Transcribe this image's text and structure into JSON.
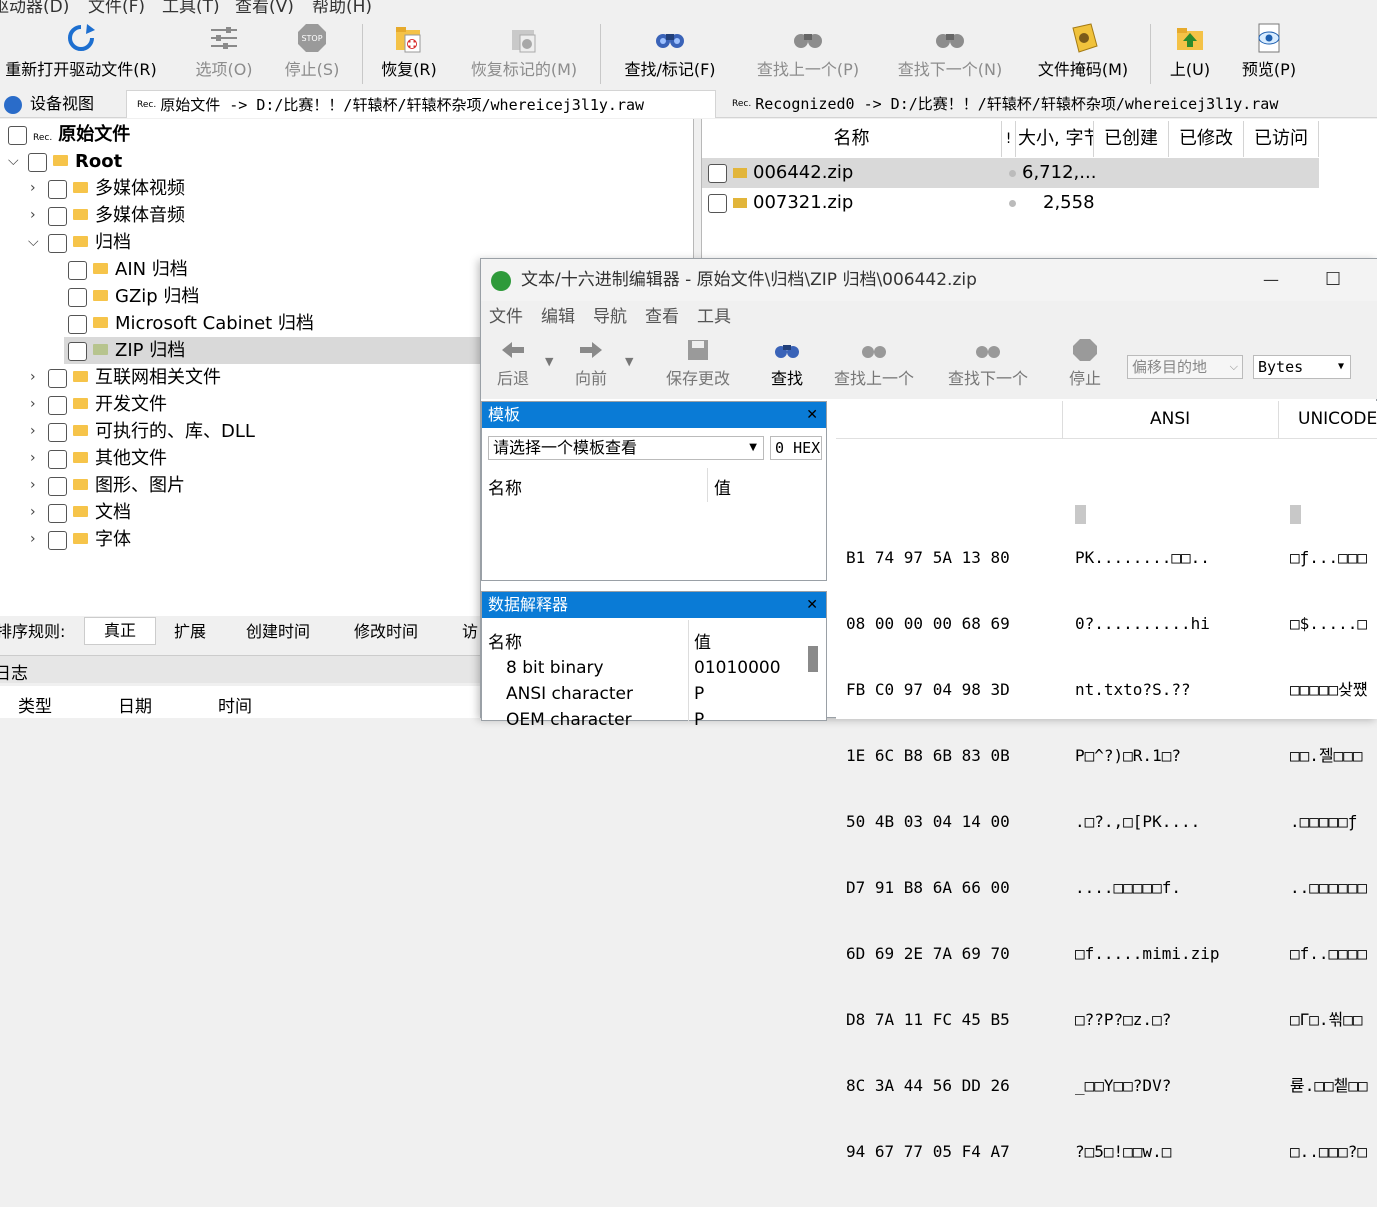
{
  "menubar": {
    "items": [
      "驱动器(D)",
      "文件(F)",
      "工具(T)",
      "查看(V)",
      "帮助(H)"
    ]
  },
  "toolbar": {
    "reopen": "重新打开驱动文件(R)",
    "options": "选项(O)",
    "stop": "停止(S)",
    "recover": "恢复(R)",
    "recover_marked": "恢复标记的(M)",
    "find_mark": "查找/标记(F)",
    "find_prev": "查找上一个(P)",
    "find_next": "查找下一个(N)",
    "file_mask": "文件掩码(M)",
    "up": "上(U)",
    "preview": "预览(P)"
  },
  "tabs": {
    "device_view": "设备视图",
    "tab1": "原始文件 -> D:/比赛！！/轩辕杯/轩辕杯杂项/whereicej3l1y.raw",
    "tab2": "Recognized0 -> D:/比赛！！/轩辕杯/轩辕杯杂项/whereicej3l1y.raw",
    "rec_badge": "Rec."
  },
  "tree": {
    "root_label": "原始文件",
    "root": "Root",
    "items": [
      "多媒体视频",
      "多媒体音频",
      "归档",
      "AIN 归档",
      "GZip 归档",
      "Microsoft Cabinet 归档",
      "ZIP 归档",
      "互联网相关文件",
      "开发文件",
      "可执行的、库、DLL",
      "其他文件",
      "图形、图片",
      "文档",
      "字体"
    ]
  },
  "files": {
    "headers": {
      "name": "名称",
      "flag": "!",
      "size": "大小, 字节",
      "created": "已创建",
      "modified": "已修改",
      "accessed": "已访问"
    },
    "rows": [
      {
        "name": "006442.zip",
        "size": "6,712,..."
      },
      {
        "name": "007321.zip",
        "size": "2,558"
      }
    ]
  },
  "sortbar": {
    "label": "排序规则:",
    "items": [
      "真正",
      "扩展",
      "创建时间",
      "修改时间",
      "访"
    ]
  },
  "log": {
    "title": "日志",
    "headers": [
      "类型",
      "日期",
      "时间"
    ]
  },
  "editor": {
    "title": "文本/十六进制编辑器 - 原始文件\\归档\\ZIP 归档\\006442.zip",
    "minimize": "—",
    "maximize": "☐",
    "menu": [
      "文件",
      "编辑",
      "导航",
      "查看",
      "工具"
    ],
    "tools": {
      "back": "后退",
      "forward": "向前",
      "save": "保存更改",
      "find": "查找",
      "find_prev": "查找上一个",
      "find_next": "查找下一个",
      "stop": "停止"
    },
    "offset_placeholder": "偏移目的地",
    "unit": "Bytes",
    "template": {
      "title": "模板",
      "select": "请选择一个模板查看",
      "offset": "0",
      "hex": "HEX",
      "col_name": "名称",
      "col_value": "值"
    },
    "interpreter": {
      "title": "数据解释器",
      "col_name": "名称",
      "col_value": "值",
      "rows": [
        {
          "name": "8 bit binary",
          "value": "01010000"
        },
        {
          "name": "ANSI character",
          "value": "P"
        },
        {
          "name": "OEM character",
          "value": "P"
        }
      ]
    },
    "hex_headers": {
      "ansi": "ANSI",
      "unicode": "UNICODE"
    },
    "hex_rows": [
      "B1 74 97 5A 13 80",
      "08 00 00 00 68 69",
      "FB C0 97 04 98 3D",
      "1E 6C B8 6B 83 0B",
      "50 4B 03 04 14 00",
      "D7 91 B8 6A 66 00",
      "6D 69 2E 7A 69 70",
      "D8 7A 11 FC 45 B5",
      "8C 3A 44 56 DD 26",
      "94 67 77 05 F4 A7"
    ],
    "ansi_rows": [
      "PK........□□..",
      "0?..........hi",
      "nt.txto?S.??",
      "P□^?)□R.1□?",
      ".□?.,□[PK....",
      "....□□□□□f.",
      "□f.....mimi.zip",
      "□??P?□z.□?",
      "_□□Y□□?DV?",
      "?□5□!□□w.□"
    ],
    "unicode_rows": [
      "□ƒ...□□□",
      "□$.....□",
      "□□□□□샂쩄",
      "□□.젤□□□",
      ".□□□□□ƒ",
      "..□□□□□□",
      "□f..□□□□",
      "□Γ□.쐮□□",
      "륟.□□쳍□□",
      "□..□□□?□"
    ]
  }
}
